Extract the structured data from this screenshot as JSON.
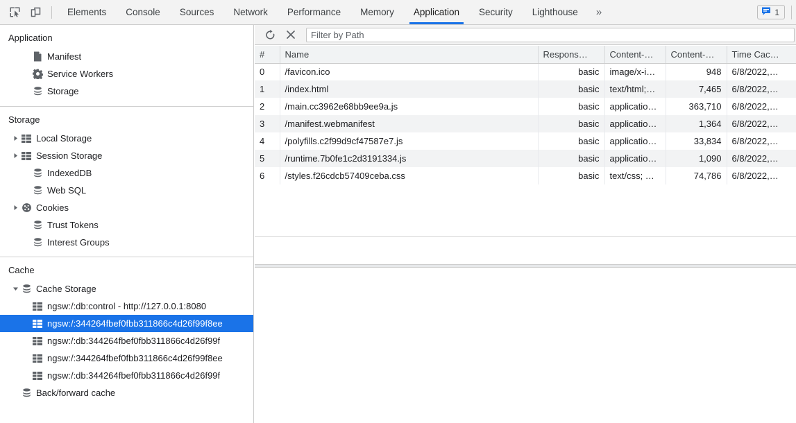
{
  "toolbar": {
    "inspect_icon": "inspect-cursor-icon",
    "device_icon": "device-toolbar-icon",
    "tabs": [
      {
        "label": "Elements",
        "active": false
      },
      {
        "label": "Console",
        "active": false
      },
      {
        "label": "Sources",
        "active": false
      },
      {
        "label": "Network",
        "active": false
      },
      {
        "label": "Performance",
        "active": false
      },
      {
        "label": "Memory",
        "active": false
      },
      {
        "label": "Application",
        "active": true
      },
      {
        "label": "Security",
        "active": false
      },
      {
        "label": "Lighthouse",
        "active": false
      }
    ],
    "more_tabs_label": "»",
    "message_badge": {
      "icon": "message-bubble-icon",
      "count": "1",
      "accent_color": "#1a73e8"
    }
  },
  "sidebar": {
    "sections": [
      {
        "title": "Application",
        "items": [
          {
            "label": "Manifest",
            "icon": "document-icon",
            "indent": 2,
            "arrow": "none",
            "selected": false
          },
          {
            "label": "Service Workers",
            "icon": "gear-icon",
            "indent": 2,
            "arrow": "none",
            "selected": false
          },
          {
            "label": "Storage",
            "icon": "database-icon",
            "indent": 2,
            "arrow": "none",
            "selected": false
          }
        ]
      },
      {
        "title": "Storage",
        "items": [
          {
            "label": "Local Storage",
            "icon": "table-grid-icon",
            "indent": 1,
            "arrow": "collapsed",
            "selected": false
          },
          {
            "label": "Session Storage",
            "icon": "table-grid-icon",
            "indent": 1,
            "arrow": "collapsed",
            "selected": false
          },
          {
            "label": "IndexedDB",
            "icon": "database-icon",
            "indent": 2,
            "arrow": "none",
            "selected": false
          },
          {
            "label": "Web SQL",
            "icon": "database-icon",
            "indent": 2,
            "arrow": "none",
            "selected": false
          },
          {
            "label": "Cookies",
            "icon": "cookie-icon",
            "indent": 1,
            "arrow": "collapsed",
            "selected": false
          },
          {
            "label": "Trust Tokens",
            "icon": "database-icon",
            "indent": 2,
            "arrow": "none",
            "selected": false
          },
          {
            "label": "Interest Groups",
            "icon": "database-icon",
            "indent": 2,
            "arrow": "none",
            "selected": false
          }
        ]
      },
      {
        "title": "Cache",
        "items": [
          {
            "label": "Cache Storage",
            "icon": "database-icon",
            "indent": 1,
            "arrow": "expanded",
            "selected": false
          },
          {
            "label": "ngsw:/:db:control - http://127.0.0.1:8080",
            "icon": "table-grid-icon",
            "indent": 2,
            "arrow": "none",
            "selected": false
          },
          {
            "label": "ngsw:/:344264fbef0fbb311866c4d26f99f8ee",
            "icon": "table-grid-icon",
            "indent": 2,
            "arrow": "none",
            "selected": true
          },
          {
            "label": "ngsw:/:db:344264fbef0fbb311866c4d26f99f",
            "icon": "table-grid-icon",
            "indent": 2,
            "arrow": "none",
            "selected": false
          },
          {
            "label": "ngsw:/:344264fbef0fbb311866c4d26f99f8ee",
            "icon": "table-grid-icon",
            "indent": 2,
            "arrow": "none",
            "selected": false
          },
          {
            "label": "ngsw:/:db:344264fbef0fbb311866c4d26f99f",
            "icon": "table-grid-icon",
            "indent": 2,
            "arrow": "none",
            "selected": false
          },
          {
            "label": "Back/forward cache",
            "icon": "database-icon",
            "indent": 1,
            "arrow": "none",
            "selected": false
          }
        ]
      }
    ],
    "selection_color": "#1a73e8"
  },
  "panel": {
    "refresh_icon": "refresh-icon",
    "delete_icon": "close-x-icon",
    "filter_placeholder": "Filter by Path",
    "filter_value": "",
    "table": {
      "columns": [
        "#",
        "Name",
        "Respons…",
        "Content-…",
        "Content-…",
        "Time Cac…"
      ],
      "rows": [
        [
          "0",
          "/favicon.ico",
          "basic",
          "image/x-i…",
          "948",
          "6/8/2022,…"
        ],
        [
          "1",
          "/index.html",
          "basic",
          "text/html;…",
          "7,465",
          "6/8/2022,…"
        ],
        [
          "2",
          "/main.cc3962e68bb9ee9a.js",
          "basic",
          "applicatio…",
          "363,710",
          "6/8/2022,…"
        ],
        [
          "3",
          "/manifest.webmanifest",
          "basic",
          "applicatio…",
          "1,364",
          "6/8/2022,…"
        ],
        [
          "4",
          "/polyfills.c2f99d9cf47587e7.js",
          "basic",
          "applicatio…",
          "33,834",
          "6/8/2022,…"
        ],
        [
          "5",
          "/runtime.7b0fe1c2d3191334.js",
          "basic",
          "applicatio…",
          "1,090",
          "6/8/2022,…"
        ],
        [
          "6",
          "/styles.f26cdcb57409ceba.css",
          "basic",
          "text/css; …",
          "74,786",
          "6/8/2022,…"
        ]
      ]
    }
  }
}
